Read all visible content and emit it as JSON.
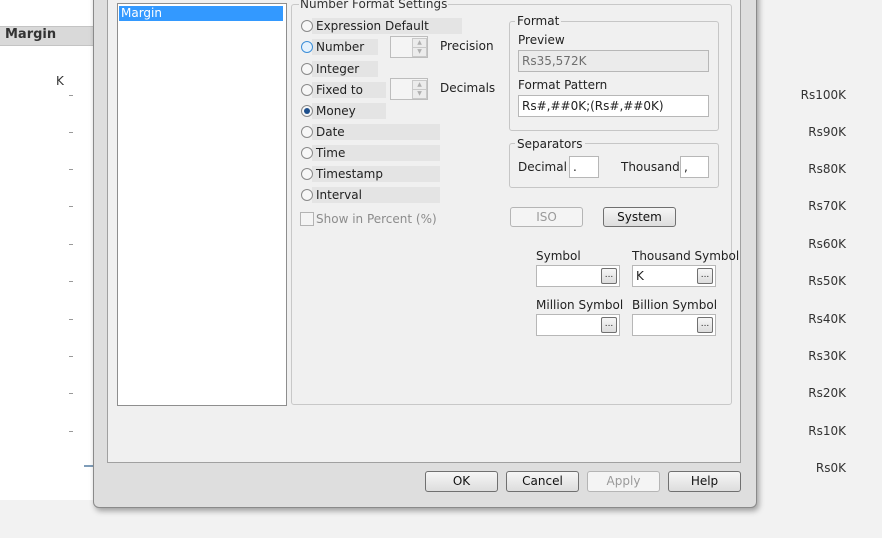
{
  "chart": {
    "title": "Margin",
    "unit": "K",
    "ticks": [
      "Rs100K",
      "Rs90K",
      "Rs80K",
      "Rs70K",
      "Rs60K",
      "Rs50K",
      "Rs40K",
      "Rs30K",
      "Rs20K",
      "Rs10K",
      "Rs0K"
    ]
  },
  "field_list": {
    "items": [
      "Margin"
    ],
    "selected": "Margin"
  },
  "number_format": {
    "legend": "Number Format Settings",
    "options": [
      "Expression Default",
      "Number",
      "Integer",
      "Fixed to",
      "Money",
      "Date",
      "Time",
      "Timestamp",
      "Interval"
    ],
    "selected": "Money",
    "precision_label": "Precision",
    "decimals_label": "Decimals",
    "show_in_percent": "Show in Percent (%)"
  },
  "format": {
    "legend": "Format",
    "preview_label": "Preview",
    "preview_value": "Rs35,572K",
    "pattern_label": "Format Pattern",
    "pattern_value": "Rs#,##0K;(Rs#,##0K)"
  },
  "separators": {
    "legend": "Separators",
    "decimal_label": "Decimal",
    "decimal_value": ".",
    "thousand_label": "Thousand",
    "thousand_value": ","
  },
  "buttons": {
    "iso": "ISO",
    "system": "System",
    "ok": "OK",
    "cancel": "Cancel",
    "apply": "Apply",
    "help": "Help"
  },
  "symbols": {
    "symbol_label": "Symbol",
    "symbol_value": "",
    "thousand_label": "Thousand Symbol",
    "thousand_value": "K",
    "million_label": "Million Symbol",
    "million_value": "",
    "billion_label": "Billion Symbol",
    "billion_value": "",
    "browse": "..."
  },
  "colors": {
    "selection": "#3399ff",
    "radio_checked": "#1d4f8c"
  }
}
